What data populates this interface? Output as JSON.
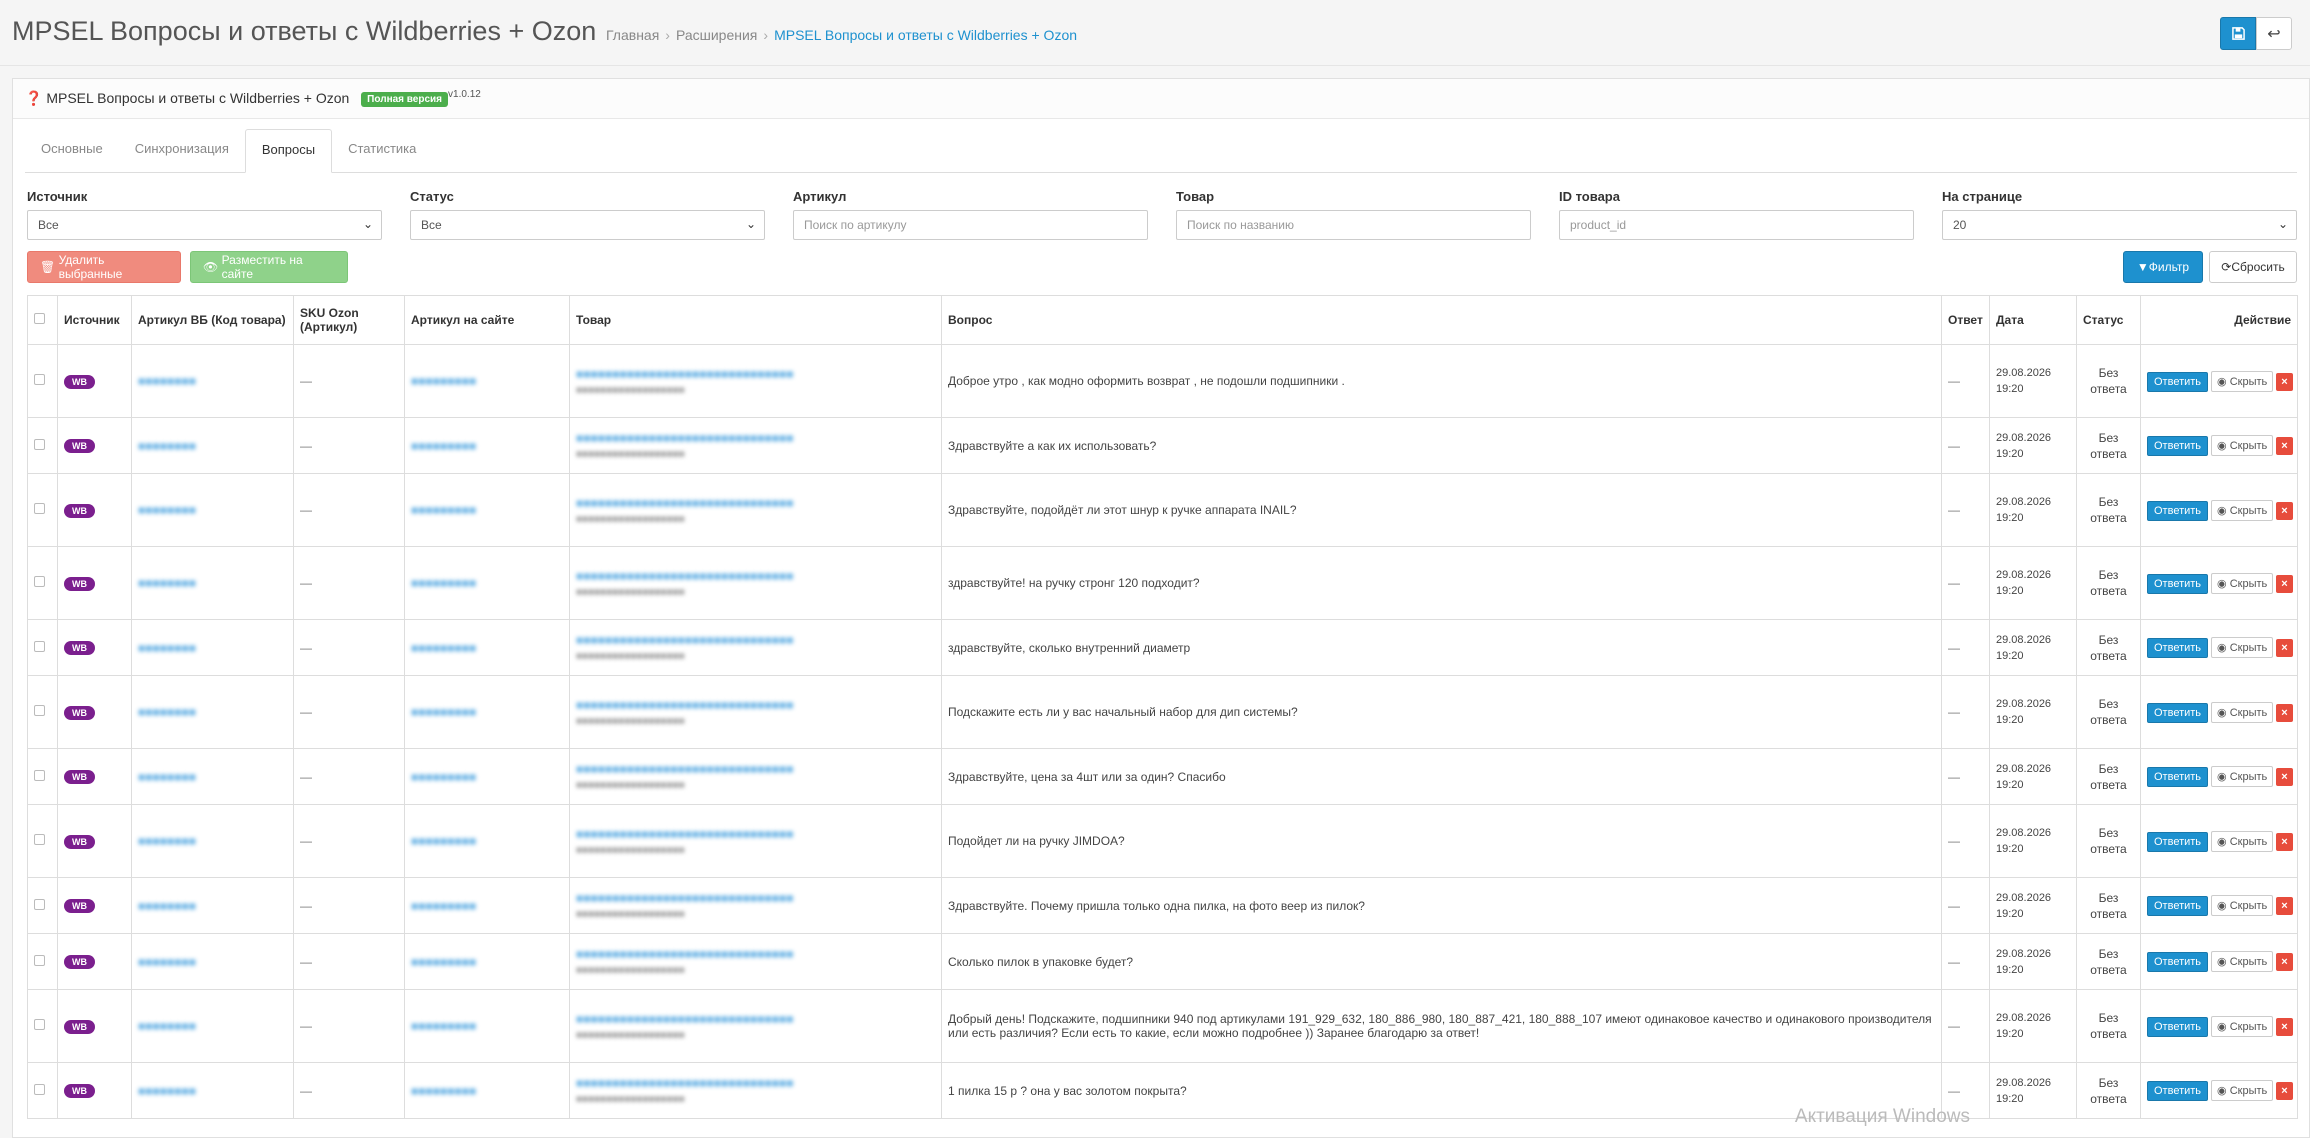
{
  "header": {
    "title": "MPSEL Вопросы и ответы с Wildberries + Ozon",
    "breadcrumb": [
      "Главная",
      "Расширения",
      "MPSEL Вопросы и ответы с Wildberries + Ozon"
    ]
  },
  "panel": {
    "title": "MPSEL Вопросы и ответы с Wildberries + Ozon",
    "badge": "Полная версия",
    "version": "v1.0.12"
  },
  "tabs": [
    "Основные",
    "Синхронизация",
    "Вопросы",
    "Статистика"
  ],
  "active_tab": "Вопросы",
  "filters": {
    "source": {
      "label": "Источник",
      "value": "Все"
    },
    "status": {
      "label": "Статус",
      "value": "Все"
    },
    "article": {
      "label": "Артикул",
      "placeholder": "Поиск по артикулу"
    },
    "product": {
      "label": "Товар",
      "placeholder": "Поиск по названию"
    },
    "product_id": {
      "label": "ID товара",
      "placeholder": "product_id"
    },
    "per_page": {
      "label": "На странице",
      "value": "20"
    }
  },
  "buttons": {
    "delete_selected": "Удалить выбранные",
    "publish": "Разместить на сайте",
    "filter": "Фильтр",
    "reset": "Сбросить",
    "answer": "Ответить",
    "hide": "Скрыть",
    "delete": "×"
  },
  "table": {
    "headers": [
      "Источник",
      "Артикул ВБ (Код товара)",
      "SKU Ozon (Артикул)",
      "Артикул на сайте",
      "Товар",
      "Вопрос",
      "Ответ",
      "Дата",
      "Статус",
      "Действие"
    ],
    "rows": [
      {
        "source": "WB",
        "question": "Доброе утро , как модно оформить возврат , не подошли подшипники .",
        "answer": "—",
        "sku": "—",
        "date": "29.08.2026",
        "time": "19:20",
        "status": "Без ответа"
      },
      {
        "source": "WB",
        "question": "Здравствуйте а как их использовать?",
        "answer": "—",
        "sku": "—",
        "date": "29.08.2026",
        "time": "19:20",
        "status": "Без ответа"
      },
      {
        "source": "WB",
        "question": "Здравствуйте, подойдёт ли этот шнур к ручке аппарата INAIL?",
        "answer": "—",
        "sku": "—",
        "date": "29.08.2026",
        "time": "19:20",
        "status": "Без ответа"
      },
      {
        "source": "WB",
        "question": "здравствуйте! на ручку стронг 120 подходит?",
        "answer": "—",
        "sku": "—",
        "date": "29.08.2026",
        "time": "19:20",
        "status": "Без ответа"
      },
      {
        "source": "WB",
        "question": "здравствуйте, сколько внутренний диаметр",
        "answer": "—",
        "sku": "—",
        "date": "29.08.2026",
        "time": "19:20",
        "status": "Без ответа"
      },
      {
        "source": "WB",
        "question": "Подскажите есть ли у вас начальный набор для дип системы?",
        "answer": "—",
        "sku": "—",
        "date": "29.08.2026",
        "time": "19:20",
        "status": "Без ответа"
      },
      {
        "source": "WB",
        "question": "Здравствуйте, цена за 4шт или за один? Спасибо",
        "answer": "—",
        "sku": "—",
        "date": "29.08.2026",
        "time": "19:20",
        "status": "Без ответа"
      },
      {
        "source": "WB",
        "question": "Подойдет ли на ручку JIMDOA?",
        "answer": "—",
        "sku": "—",
        "date": "29.08.2026",
        "time": "19:20",
        "status": "Без ответа"
      },
      {
        "source": "WB",
        "question": "Здравствуйте. Почему пришла только одна пилка, на фото веер из пилок?",
        "answer": "—",
        "sku": "—",
        "date": "29.08.2026",
        "time": "19:20",
        "status": "Без ответа"
      },
      {
        "source": "WB",
        "question": "Сколько пилок в упаковке будет?",
        "answer": "—",
        "sku": "—",
        "date": "29.08.2026",
        "time": "19:20",
        "status": "Без ответа"
      },
      {
        "source": "WB",
        "question": "Добрый день! Подскажите, подшипники 940 под артикулами 191_929_632, 180_886_980, 180_887_421, 180_888_107 имеют одинаковое качество и одинакового производителя или есть различия? Если есть то какие, если можно подробнее )) Заранее благодарю за ответ!",
        "answer": "—",
        "sku": "—",
        "date": "29.08.2026",
        "time": "19:20",
        "status": "Без ответа"
      },
      {
        "source": "WB",
        "question": "1 пилка 15 р ? она у вас золотом покрыта?",
        "answer": "—",
        "sku": "—",
        "date": "29.08.2026",
        "time": "19:20",
        "status": "Без ответа"
      }
    ]
  },
  "watermark": "Активация Windows"
}
